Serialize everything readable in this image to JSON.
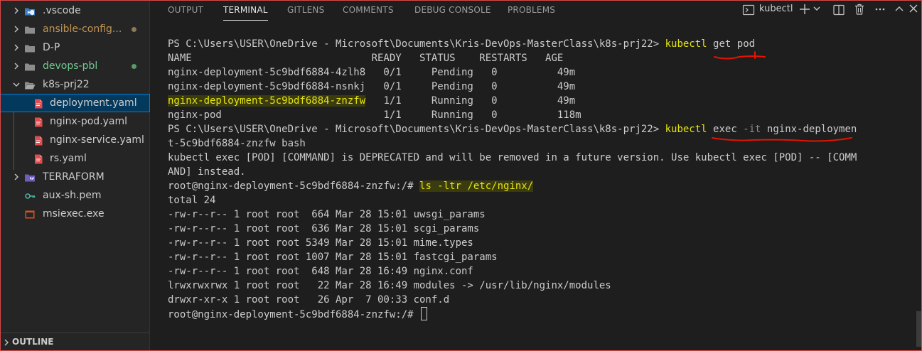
{
  "explorer": {
    "items": [
      {
        "label": ".vscode",
        "kind": "folder",
        "icon": "vscode-folder-icon",
        "expanded": false,
        "color": "#cccccc"
      },
      {
        "label": "ansible-config...",
        "kind": "folder",
        "icon": "folder-icon",
        "expanded": false,
        "color": "#c09553",
        "dot": "#8a7a5a"
      },
      {
        "label": "D-P",
        "kind": "folder",
        "icon": "folder-icon",
        "expanded": false,
        "color": "#cccccc"
      },
      {
        "label": "devops-pbl",
        "kind": "folder",
        "icon": "folder-icon",
        "expanded": false,
        "color": "#73c991",
        "dot": "#5a9a6a"
      },
      {
        "label": "k8s-prj22",
        "kind": "folder",
        "icon": "folder-open-icon",
        "expanded": true,
        "color": "#cccccc"
      },
      {
        "label": "deployment.yaml",
        "kind": "file",
        "icon": "yaml-file-icon",
        "color": "#cccccc",
        "selected": true
      },
      {
        "label": "nginx-pod.yaml",
        "kind": "file",
        "icon": "yaml-file-icon",
        "color": "#cccccc"
      },
      {
        "label": "nginx-service.yaml",
        "kind": "file",
        "icon": "yaml-file-icon",
        "color": "#cccccc"
      },
      {
        "label": "rs.yaml",
        "kind": "file",
        "icon": "yaml-file-icon",
        "color": "#cccccc"
      },
      {
        "label": "TERRAFORM",
        "kind": "folder",
        "icon": "terraform-folder-icon",
        "expanded": false,
        "color": "#cccccc"
      },
      {
        "label": "aux-sh.pem",
        "kind": "file",
        "icon": "key-file-icon",
        "color": "#cccccc"
      },
      {
        "label": "msiexec.exe",
        "kind": "file",
        "icon": "exe-file-icon",
        "color": "#cccccc"
      }
    ],
    "outline_label": "OUTLINE"
  },
  "panel": {
    "tabs": [
      {
        "label": "OUTPUT",
        "active": false
      },
      {
        "label": "TERMINAL",
        "active": true
      },
      {
        "label": "GITLENS",
        "active": false
      },
      {
        "label": "COMMENTS",
        "active": false
      },
      {
        "label": "DEBUG CONSOLE",
        "active": false
      },
      {
        "label": "PROBLEMS",
        "active": false
      }
    ],
    "terminal_name": "kubectl"
  },
  "colors": {
    "accent": "#007fd4",
    "command_yellow": "#e5e510",
    "annotation_red": "#e51400"
  },
  "terminal": {
    "lines": [
      {
        "kind": "prompt",
        "prompt": "PS C:\\Users\\USER\\OneDrive - Microsoft\\Documents\\Kris-DevOps-MasterClass\\k8s-prj22> ",
        "parts": [
          {
            "t": "kubectl",
            "c": "y"
          },
          {
            "t": " get ",
            "c": "w"
          },
          {
            "t": "pod",
            "c": "w"
          }
        ]
      },
      {
        "kind": "text",
        "text": "NAME                              READY   STATUS    RESTARTS   AGE"
      },
      {
        "kind": "text",
        "text": "nginx-deployment-5c9bdf6884-4zlh8   0/1     Pending   0          49m"
      },
      {
        "kind": "text",
        "text": "nginx-deployment-5c9bdf6884-nsnkj   0/1     Pending   0          49m"
      },
      {
        "kind": "hlrow",
        "hl": "nginx-deployment-5c9bdf6884-znzfw",
        "text": "   1/1     Running   0          49m"
      },
      {
        "kind": "text",
        "text": "nginx-pod                           1/1     Running   0          118m"
      },
      {
        "kind": "prompt",
        "prompt": "PS C:\\Users\\USER\\OneDrive - Microsoft\\Documents\\Kris-DevOps-MasterClass\\k8s-prj22> ",
        "parts": [
          {
            "t": "kubectl",
            "c": "y"
          },
          {
            "t": " exec ",
            "c": "w"
          },
          {
            "t": "-it",
            "c": "g"
          },
          {
            "t": " nginx-deploymen",
            "c": "w"
          }
        ]
      },
      {
        "kind": "text",
        "text": "t-5c9bdf6884-znzfw bash"
      },
      {
        "kind": "text",
        "text": "kubectl exec [POD] [COMMAND] is DEPRECATED and will be removed in a future version. Use kubectl exec [POD] -- [COMM"
      },
      {
        "kind": "text",
        "text": "AND] instead."
      },
      {
        "kind": "rootcmd",
        "prompt": "root@nginx-deployment-5c9bdf6884-znzfw:/# ",
        "cmd": "ls -ltr /etc/nginx/"
      },
      {
        "kind": "text",
        "text": "total 24"
      },
      {
        "kind": "text",
        "text": "-rw-r--r-- 1 root root  664 Mar 28 15:01 uwsgi_params"
      },
      {
        "kind": "text",
        "text": "-rw-r--r-- 1 root root  636 Mar 28 15:01 scgi_params"
      },
      {
        "kind": "text",
        "text": "-rw-r--r-- 1 root root 5349 Mar 28 15:01 mime.types"
      },
      {
        "kind": "text",
        "text": "-rw-r--r-- 1 root root 1007 Mar 28 15:01 fastcgi_params"
      },
      {
        "kind": "text",
        "text": "-rw-r--r-- 1 root root  648 Mar 28 16:49 nginx.conf"
      },
      {
        "kind": "text",
        "text": "lrwxrwxrwx 1 root root   22 Mar 28 16:49 modules -> /usr/lib/nginx/modules"
      },
      {
        "kind": "text",
        "text": "drwxr-xr-x 1 root root   26 Apr  7 00:33 conf.d"
      },
      {
        "kind": "cursor",
        "prompt": "root@nginx-deployment-5c9bdf6884-znzfw:/# "
      }
    ]
  }
}
